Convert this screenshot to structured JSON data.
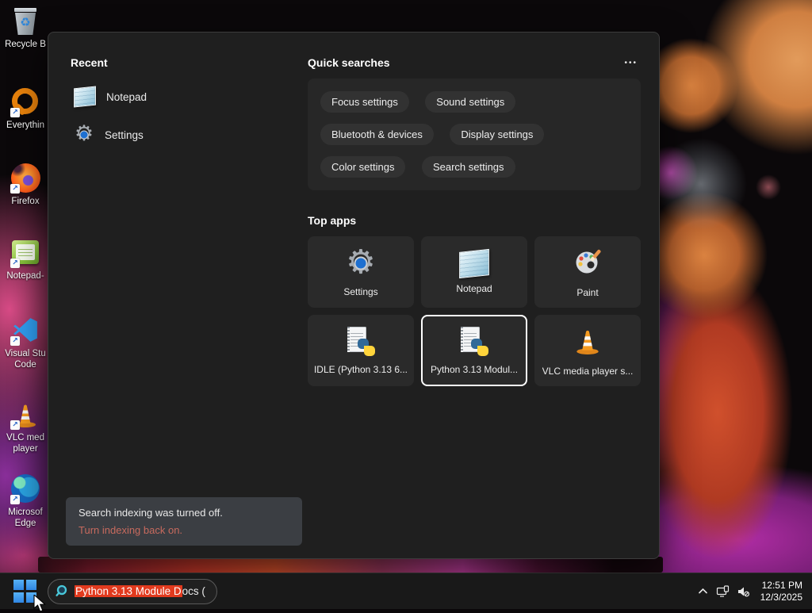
{
  "desktop_icons": [
    {
      "id": "recycle-bin",
      "line1": "Recycle B",
      "line2": ""
    },
    {
      "id": "everything",
      "line1": "Everythin",
      "line2": ""
    },
    {
      "id": "firefox",
      "line1": "Firefox",
      "line2": ""
    },
    {
      "id": "notepad-plus-plus",
      "line1": "Notepad-",
      "line2": ""
    },
    {
      "id": "visual-studio-code",
      "line1": "Visual Stu",
      "line2": "Code"
    },
    {
      "id": "vlc-media-player",
      "line1": "VLC med",
      "line2": "player"
    },
    {
      "id": "microsoft-edge",
      "line1": "Microsof",
      "line2": "Edge"
    }
  ],
  "search_panel": {
    "recent": {
      "title": "Recent",
      "items": [
        {
          "icon": "notepad-icon",
          "label": "Notepad"
        },
        {
          "icon": "settings-gear-icon",
          "label": "Settings"
        }
      ]
    },
    "quick_searches": {
      "title": "Quick searches",
      "more_label": "•••",
      "pills": [
        "Focus settings",
        "Sound settings",
        "Bluetooth & devices",
        "Display settings",
        "Color settings",
        "Search settings"
      ]
    },
    "top_apps": {
      "title": "Top apps",
      "tiles": [
        {
          "label": "Settings",
          "icon": "settings-gear-icon",
          "selected": false
        },
        {
          "label": "Notepad",
          "icon": "notepad-icon",
          "selected": false
        },
        {
          "label": "Paint",
          "icon": "paint-palette-icon",
          "selected": false
        },
        {
          "label": "IDLE (Python 3.13 6...",
          "icon": "python-doc-icon",
          "selected": false
        },
        {
          "label": "Python 3.13 Modul...",
          "icon": "python-doc-icon",
          "selected": true
        },
        {
          "label": "VLC media player s...",
          "icon": "vlc-cone-icon",
          "selected": false
        }
      ]
    },
    "indexing_notice": {
      "message": "Search indexing was turned off.",
      "action_link": "Turn indexing back on."
    }
  },
  "taskbar": {
    "search_box": {
      "selected_text": "Python 3.13 Module D",
      "unselected_text": "ocs ("
    },
    "tray": {
      "time": "12:51 PM",
      "date": "12/3/2025"
    }
  },
  "colors": {
    "selection_red": "#e23a1e",
    "notice_link_red": "#c76a5e",
    "selected_tile_border": "#ffffff",
    "taskbar_accent_blue": "#3f9ef5"
  }
}
